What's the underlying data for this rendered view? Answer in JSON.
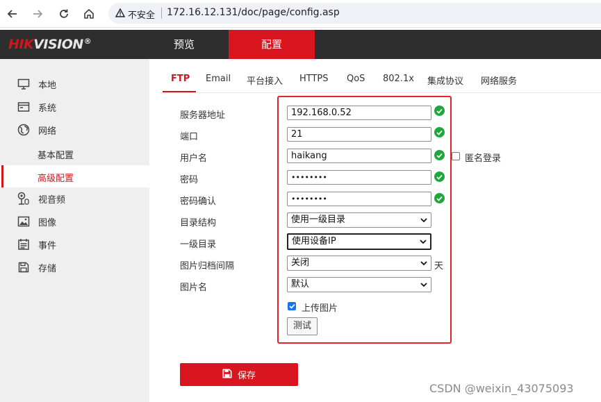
{
  "browser": {
    "security_label": "不安全",
    "url": "172.16.12.131/doc/page/config.asp"
  },
  "brand": {
    "logo_part1": "HIK",
    "logo_part2": "VISION",
    "logo_reg": "®"
  },
  "topnav": {
    "preview": "预览",
    "config": "配置"
  },
  "sidebar": {
    "local": "本地",
    "system": "系统",
    "network": "网络",
    "basic_config": "基本配置",
    "advanced_config": "高级配置",
    "video_audio": "视音频",
    "image": "图像",
    "event": "事件",
    "storage": "存储"
  },
  "tabs": [
    "FTP",
    "Email",
    "平台接入",
    "HTTPS",
    "QoS",
    "802.1x",
    "集成协议",
    "网络服务"
  ],
  "form": {
    "server_address_label": "服务器地址",
    "server_address_value": "192.168.0.52",
    "port_label": "端口",
    "port_value": "21",
    "username_label": "用户名",
    "username_value": "haikang",
    "anonymous_label": "匿名登录",
    "password_label": "密码",
    "password_value": "••••••••",
    "password_confirm_label": "密码确认",
    "password_confirm_value": "••••••••",
    "dir_structure_label": "目录结构",
    "dir_structure_value": "使用一级目录",
    "dir1_label": "一级目录",
    "dir1_value": "使用设备IP",
    "interval_label": "图片归档间隔",
    "interval_value": "关闭",
    "interval_unit": "天",
    "picture_name_label": "图片名",
    "picture_name_value": "默认",
    "upload_picture_label": "上传图片",
    "upload_picture_checked": true,
    "test_button": "测试",
    "save_button": "保存"
  },
  "watermark": "CSDN @weixin_43075093",
  "colors": {
    "accent": "#d9161f",
    "header_bg": "#2e2e2e",
    "sidebar_bg": "#efefef",
    "ok_green": "#1ea83c",
    "highlight_box": "#e8202a"
  }
}
